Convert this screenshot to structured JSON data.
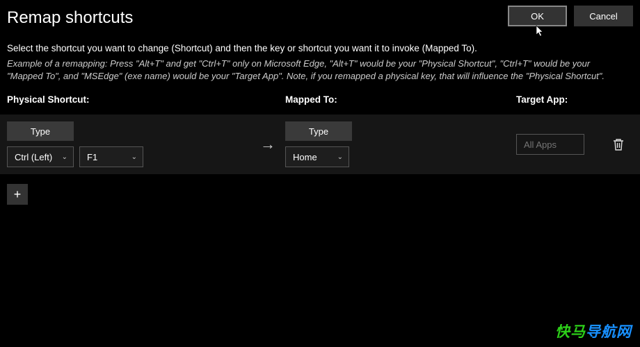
{
  "header": {
    "title": "Remap shortcuts",
    "ok_label": "OK",
    "cancel_label": "Cancel"
  },
  "instruction": "Select the shortcut you want to change (Shortcut) and then the key or shortcut you want it to invoke (Mapped To).",
  "example": "Example of a remapping: Press \"Alt+T\" and get \"Ctrl+T\" only on Microsoft Edge, \"Alt+T\" would be your \"Physical Shortcut\", \"Ctrl+T\" would be your \"Mapped To\", and \"MSEdge\" (exe name) would be your \"Target App\". Note, if you remapped a physical key, that will influence the \"Physical Shortcut\".",
  "columns": {
    "physical": "Physical Shortcut:",
    "mapped": "Mapped To:",
    "target": "Target App:"
  },
  "row": {
    "physical": {
      "type_label": "Type",
      "key1": "Ctrl (Left)",
      "key2": "F1"
    },
    "mapped": {
      "type_label": "Type",
      "key1": "Home"
    },
    "target": {
      "placeholder": "All Apps",
      "value": ""
    }
  },
  "add_label": "+",
  "watermark": "快马导航网"
}
